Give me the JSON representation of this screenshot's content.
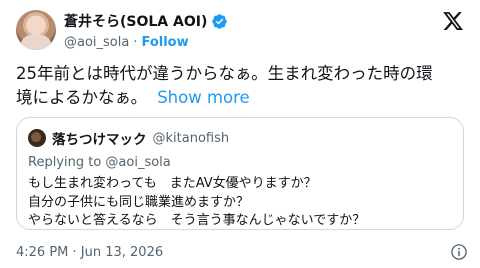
{
  "author": {
    "display_name": "蒼井そら(SOLA AOI)",
    "handle": "@aoi_sola",
    "separator": "·",
    "follow_label": "Follow",
    "verified": true,
    "verified_color": "#1d9bf0"
  },
  "tweet": {
    "text_line1": "25年前とは時代が違うからなぁ。生まれ変わった時の環",
    "text_line2": "境によるかなぁ。",
    "show_more_label": "Show more",
    "timestamp": "4:26 PM · Jun 13, 2026"
  },
  "quoted_tweet": {
    "display_name": "落ちつけマック",
    "handle": "@kitanofish",
    "replying_to": "Replying to @aoi_sola",
    "lines": [
      "もし生まれ変わっても　またAV女優やりますか？",
      "自分の子供にも同じ職業進めますか？",
      "やらないと答えるなら　そう言う事なんじゃないですか？"
    ]
  },
  "icons": {
    "logo": "x-logo-icon",
    "verified": "verified-badge-icon",
    "info": "info-icon"
  },
  "colors": {
    "link": "#1d9bf0",
    "secondary_text": "#536471",
    "border": "#cfd9de"
  }
}
